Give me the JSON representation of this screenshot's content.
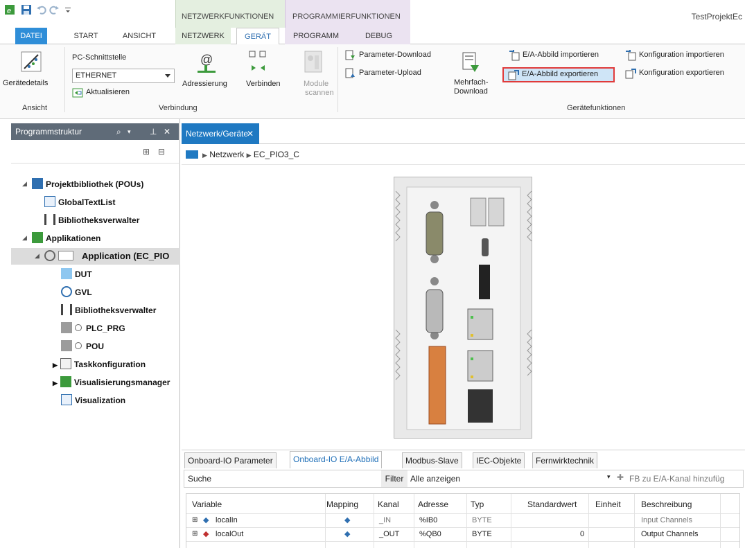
{
  "app": {
    "title": "TestProjektEc"
  },
  "context_tabs": {
    "network": "NETZWERKFUNKTIONEN",
    "program": "PROGRAMMIERFUNKTIONEN"
  },
  "tabs": {
    "file": "DATEI",
    "start": "START",
    "view": "ANSICHT",
    "network": "NETZWERK",
    "device": "GERÄT",
    "program": "PROGRAMM",
    "debug": "DEBUG"
  },
  "ribbon": {
    "device_details": "Gerätedetails",
    "pc_interface_label": "PC-Schnittstelle",
    "pc_interface_value": "ETHERNET",
    "refresh": "Aktualisieren",
    "addressing": "Adressierung",
    "connect": "Verbinden",
    "scan_modules_1": "Module",
    "scan_modules_2": "scannen",
    "param_download": "Parameter-Download",
    "param_upload": "Parameter-Upload",
    "multi_download_1": "Mehrfach-",
    "multi_download_2": "Download",
    "io_import": "E/A-Abbild importieren",
    "io_export": "E/A-Abbild exportieren",
    "config_import": "Konfiguration importieren",
    "config_export": "Konfiguration exportieren",
    "group_view": "Ansicht",
    "group_connection": "Verbindung",
    "group_device_functions": "Gerätefunktionen"
  },
  "left_panel": {
    "title": "Programmstruktur",
    "tree": [
      {
        "label": "Projektbibliothek (POUs)",
        "icon": "library-icon"
      },
      {
        "label": "GlobalTextList",
        "icon": "textlist-icon"
      },
      {
        "label": "Bibliotheksverwalter",
        "icon": "books-icon"
      },
      {
        "label": "Applikationen",
        "icon": "applications-icon"
      },
      {
        "label": "Application (EC_PIO",
        "icon": "gear-icon"
      },
      {
        "label": "DUT",
        "icon": "dut-icon"
      },
      {
        "label": "GVL",
        "icon": "globe-icon"
      },
      {
        "label": "Bibliotheksverwalter",
        "icon": "books-icon"
      },
      {
        "label": "PLC_PRG",
        "icon": "pou-icon"
      },
      {
        "label": "POU",
        "icon": "pou-icon"
      },
      {
        "label": "Taskkonfiguration",
        "icon": "task-icon"
      },
      {
        "label": "Visualisierungsmanager",
        "icon": "vismanager-icon"
      },
      {
        "label": "Visualization",
        "icon": "visualization-icon"
      }
    ]
  },
  "document": {
    "tab": "Netzwerk/Geräte",
    "breadcrumb_network": "Netzwerk",
    "breadcrumb_device": "EC_PIO3_C"
  },
  "bottom": {
    "tabs": [
      "Onboard-IO Parameter",
      "Onboard-IO E/A-Abbild",
      "Modbus-Slave",
      "IEC-Objekte",
      "Fernwirktechnik"
    ],
    "search_label": "Suche",
    "filter_label": "Filter",
    "filter_value": "Alle anzeigen",
    "add_fb": "FB zu E/A-Kanal hinzufüg",
    "columns": [
      "Variable",
      "Mapping",
      "Kanal",
      "Adresse",
      "Typ",
      "Standardwert",
      "Einheit",
      "Beschreibung"
    ],
    "rows": [
      {
        "variable": "localIn",
        "kanal": "_IN",
        "adresse": "%IB0",
        "typ": "BYTE",
        "standardwert": "",
        "einheit": "",
        "beschreibung": "Input Channels"
      },
      {
        "variable": "localOut",
        "kanal": "_OUT",
        "adresse": "%QB0",
        "typ": "BYTE",
        "standardwert": "0",
        "einheit": "",
        "beschreibung": "Output Channels"
      }
    ]
  },
  "colors": {
    "accent": "#2f8ed8",
    "panel_header": "#5f6b78",
    "highlight_border": "#e03a3a"
  }
}
